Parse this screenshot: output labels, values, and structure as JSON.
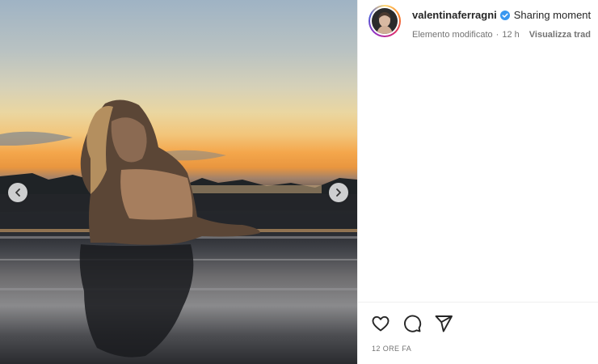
{
  "post": {
    "username": "valentinaferragni",
    "verified": true,
    "caption_preview": "Sharing moment",
    "edited_label": "Elemento modificato",
    "time_ago": "12 h",
    "translate_label": "Visualizza trad",
    "timestamp": "12 ORE FA"
  },
  "media": {
    "prev_icon": "chevron-left-icon",
    "next_icon": "chevron-right-icon"
  },
  "actions": {
    "like_icon": "heart-icon",
    "comment_icon": "comment-icon",
    "share_icon": "paper-plane-icon"
  },
  "colors": {
    "verified_blue": "#3897f0",
    "text_primary": "#262626",
    "text_secondary": "#737373"
  }
}
